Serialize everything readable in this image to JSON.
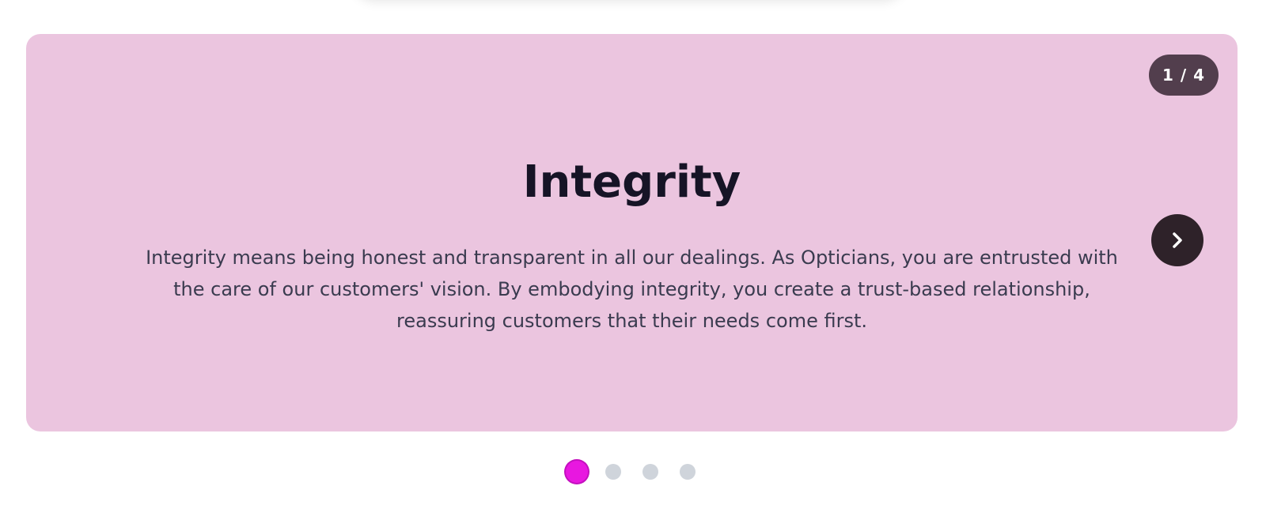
{
  "carousel": {
    "counter": "1 / 4",
    "slide": {
      "title": "Integrity",
      "body": "Integrity means being honest and transparent in all our dealings. As Opticians, you are entrusted with the care of our customers' vision. By embodying integrity, you create a trust-based relationship, reassuring customers that their needs come first."
    },
    "next_icon": "chevron-right-icon",
    "active_index": 1,
    "total_slides": 4
  },
  "colors": {
    "card_background": "#ebc5df",
    "title_text": "#161426",
    "body_text": "#3a3b4f",
    "active_dot": "#e817e0",
    "inactive_dot": "#cfd4db",
    "button_background": "#2e2229"
  }
}
